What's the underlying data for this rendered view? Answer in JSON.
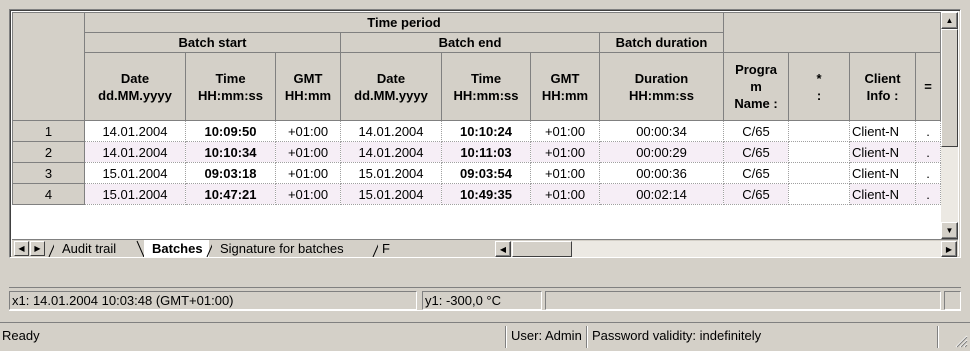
{
  "grid": {
    "header": {
      "group": "Time period",
      "batch_start": "Batch start",
      "batch_end": "Batch end",
      "batch_duration": "Batch duration"
    },
    "columns": {
      "start_date": [
        "Date",
        "dd.MM.yyyy"
      ],
      "start_time": [
        "Time",
        "HH:mm:ss"
      ],
      "start_gmt": [
        "GMT",
        "HH:mm"
      ],
      "end_date": [
        "Date",
        "dd.MM.yyyy"
      ],
      "end_time": [
        "Time",
        "HH:mm:ss"
      ],
      "end_gmt": [
        "GMT",
        "HH:mm"
      ],
      "duration": [
        "Duration",
        "HH:mm:ss"
      ],
      "program": [
        "Progra",
        "m",
        "Name :"
      ],
      "unnamed": [
        "*",
        ":"
      ],
      "client": [
        "Client",
        "Info :"
      ],
      "next": [
        "="
      ]
    },
    "rows": [
      {
        "num": "1",
        "start_date": "14.01.2004",
        "start_time": "10:09:50",
        "start_gmt": "+01:00",
        "end_date": "14.01.2004",
        "end_time": "10:10:24",
        "end_gmt": "+01:00",
        "duration": "00:00:34",
        "program": "C/65",
        "unnamed": "",
        "client": "Client-N",
        "next": "."
      },
      {
        "num": "2",
        "start_date": "14.01.2004",
        "start_time": "10:10:34",
        "start_gmt": "+01:00",
        "end_date": "14.01.2004",
        "end_time": "10:11:03",
        "end_gmt": "+01:00",
        "duration": "00:00:29",
        "program": "C/65",
        "unnamed": "",
        "client": "Client-N",
        "next": "."
      },
      {
        "num": "3",
        "start_date": "15.01.2004",
        "start_time": "09:03:18",
        "start_gmt": "+01:00",
        "end_date": "15.01.2004",
        "end_time": "09:03:54",
        "end_gmt": "+01:00",
        "duration": "00:00:36",
        "program": "C/65",
        "unnamed": "",
        "client": "Client-N",
        "next": "."
      },
      {
        "num": "4",
        "start_date": "15.01.2004",
        "start_time": "10:47:21",
        "start_gmt": "+01:00",
        "end_date": "15.01.2004",
        "end_time": "10:49:35",
        "end_gmt": "+01:00",
        "duration": "00:02:14",
        "program": "C/65",
        "unnamed": "",
        "client": "Client-N",
        "next": "."
      }
    ]
  },
  "tabs": [
    {
      "label": "Audit trail",
      "active": false
    },
    {
      "label": "Batches",
      "active": true
    },
    {
      "label": "Signature for batches",
      "active": false
    },
    {
      "label": "F",
      "active": false
    }
  ],
  "coords": {
    "x": "x1: 14.01.2004 10:03:48 (GMT+01:00)",
    "y": "y1: -300,0 °C"
  },
  "status": {
    "state": "Ready",
    "user": "User: Admin",
    "password": "Password validity: indefinitely"
  }
}
